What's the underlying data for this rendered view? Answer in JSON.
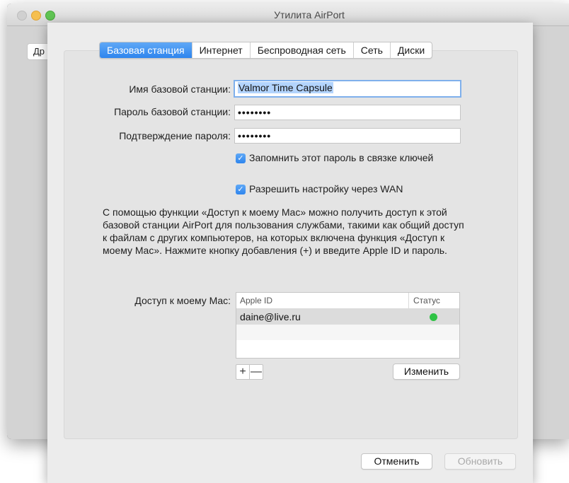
{
  "window": {
    "title": "Утилита AirPort",
    "other_button_label": "Др"
  },
  "tabs": [
    {
      "label": "Базовая станция",
      "active": true
    },
    {
      "label": "Интернет",
      "active": false
    },
    {
      "label": "Беспроводная сеть",
      "active": false
    },
    {
      "label": "Сеть",
      "active": false
    },
    {
      "label": "Диски",
      "active": false
    }
  ],
  "form": {
    "name_label": "Имя базовой станции:",
    "name_value": "Valmor Time Capsule",
    "password_label": "Пароль базовой станции:",
    "password_value": "••••••••",
    "confirm_label": "Подтверждение пароля:",
    "confirm_value": "••••••••",
    "remember_label": "Запомнить этот пароль в связке ключей",
    "remember_checked": true,
    "wan_label": "Разрешить настройку через WAN",
    "wan_checked": true
  },
  "description": "С помощью функции «Доступ к моему Mac» можно получить доступ к этой базовой станции AirPort для пользования службами, такими как общий доступ к файлам с других компьютеров, на которых включена функция «Доступ к моему Mac». Нажмите кнопку добавления (+) и введите Apple ID и пароль.",
  "access": {
    "label": "Доступ к моему Mac:",
    "columns": {
      "apple_id": "Apple ID",
      "status": "Статус"
    },
    "rows": [
      {
        "apple_id": "daine@live.ru",
        "status": "active"
      }
    ],
    "add_label": "+",
    "remove_label": "—",
    "edit_label": "Изменить"
  },
  "footer": {
    "cancel_label": "Отменить",
    "update_label": "Обновить"
  },
  "colors": {
    "accent": "#2e85ee",
    "status_green": "#2fc345"
  }
}
